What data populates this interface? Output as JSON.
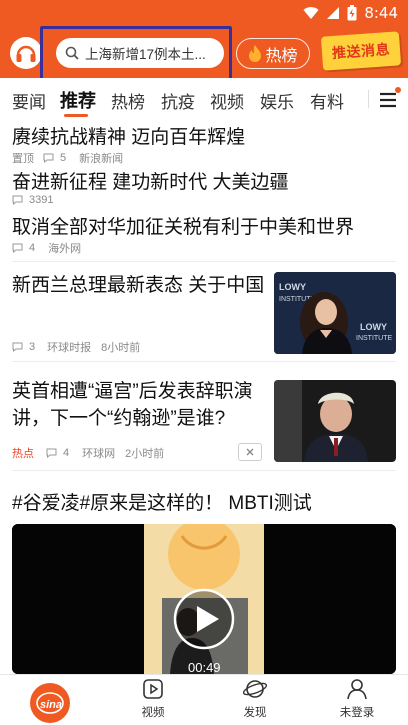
{
  "status_bar": {
    "time": "8:44",
    "icons": [
      "wifi-icon",
      "cell-signal-icon",
      "battery-icon"
    ]
  },
  "header": {
    "search_placeholder": "上海新增17例本土...",
    "hot_label": "热榜",
    "push_label": "推送消息",
    "accent_color": "#ef5a22"
  },
  "tabs": [
    {
      "label": "要闻"
    },
    {
      "label": "推荐",
      "active": true
    },
    {
      "label": "热榜"
    },
    {
      "label": "抗疫"
    },
    {
      "label": "视频"
    },
    {
      "label": "娱乐"
    },
    {
      "label": "有料"
    }
  ],
  "feed": {
    "items": [
      {
        "title": "赓续抗战精神 迈向百年辉煌",
        "tag": "置顶",
        "comments": "5",
        "source": "新浪新闻"
      },
      {
        "title": "奋进新征程 建功新时代 大美边疆",
        "comments": "3391"
      },
      {
        "title": "取消全部对华加征关税有利于中美和世界",
        "comments": "4",
        "source": "海外网"
      },
      {
        "title": "新西兰总理最新表态 关于中国",
        "comments": "3",
        "source": "环球时报",
        "time": "8小时前",
        "thumb_text": "LOWY INSTITUTE"
      },
      {
        "title_line1": "英首相遭“逼宫”后发表辞职演",
        "title_line2": "讲，下一个“约翰逊”是谁?",
        "hot": "热点",
        "comments": "4",
        "source": "环球网",
        "time": "2小时前"
      },
      {
        "title": "#谷爱凌#原来是这样的！ MBTI测试",
        "duration": "00:49"
      }
    ]
  },
  "bottom_nav": [
    {
      "label": "",
      "icon": "sina-logo-icon"
    },
    {
      "label": "视频",
      "icon": "video-play-icon"
    },
    {
      "label": "发现",
      "icon": "planet-icon"
    },
    {
      "label": "未登录",
      "icon": "user-icon"
    }
  ]
}
